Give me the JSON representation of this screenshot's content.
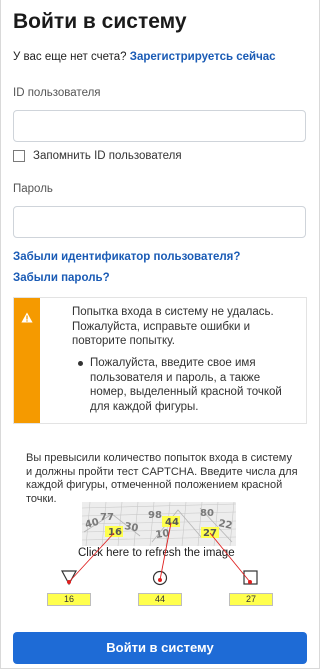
{
  "header": {
    "title": "Войти в систему",
    "no_account_text": "У вас еще нет счета?",
    "register_link": "Зарегистрируетсь сейчас"
  },
  "form": {
    "user_id_label": "ID пользователя",
    "user_id_value": "",
    "remember_label": "Запомнить ID пользователя",
    "remember_checked": false,
    "password_label": "Пароль",
    "password_value": "",
    "forgot_id_link": "Забыли идентификатор пользователя?",
    "forgot_password_link": "Забыли пароль?"
  },
  "alert": {
    "type": "warning",
    "accent_color": "#f59a00",
    "icon": "warning-icon",
    "message": "Попытка входа в систему не удалась. Пожалуйста, исправьте ошибки и повторите попытку.",
    "bullets": [
      "Пожалуйста, введите свое имя пользователя и пароль, а также номер, выделенный красной точкой для каждой фигуры."
    ]
  },
  "captcha": {
    "instructions": "Вы превысили количество попыток входа в систему и должны пройти тест CAPTCHA. Введите числа для каждой фигуры, отмеченной положением красной точки.",
    "image_numbers": [
      "40",
      "77",
      "16",
      "30",
      "98",
      "44",
      "10",
      "80",
      "22",
      "27"
    ],
    "refresh_text": "Click here to refresh the image",
    "shapes": [
      {
        "shape": "triangle-icon",
        "answer": "16"
      },
      {
        "shape": "circle-icon",
        "answer": "44"
      },
      {
        "shape": "square-icon",
        "answer": "27"
      }
    ],
    "highlight_color": "#ffff4d",
    "marker_color": "#e02020"
  },
  "submit": {
    "label": "Войти в систему",
    "color": "#1e6bd6"
  }
}
